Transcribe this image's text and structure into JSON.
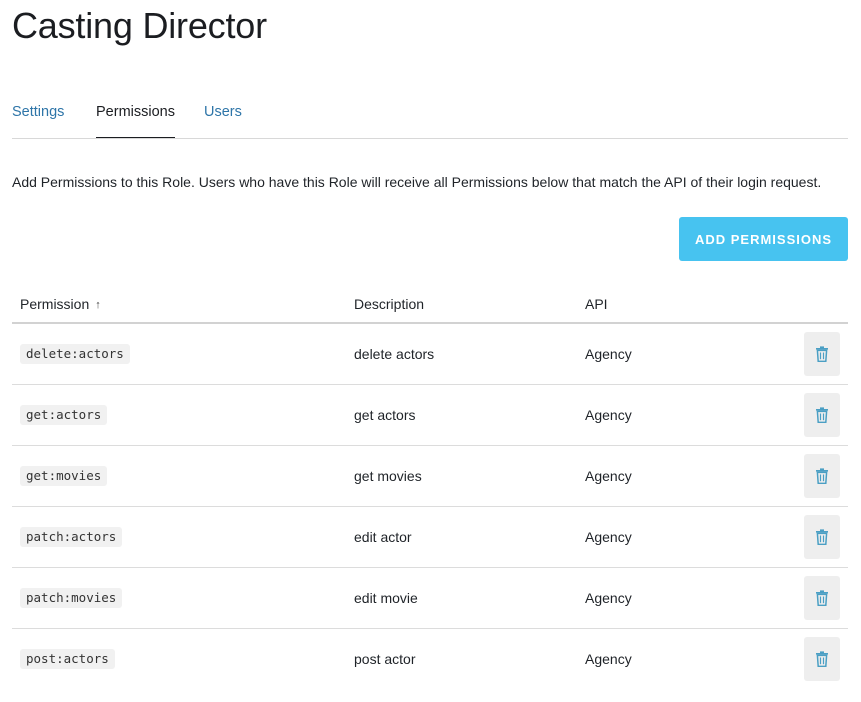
{
  "header": {
    "title": "Casting Director"
  },
  "tabs": [
    {
      "label": "Settings",
      "active": false
    },
    {
      "label": "Permissions",
      "active": true
    },
    {
      "label": "Users",
      "active": false
    }
  ],
  "intro_text": "Add Permissions to this Role. Users who have this Role will receive all Permissions below that match the API of their login request.",
  "add_button_label": "ADD PERMISSIONS",
  "table": {
    "columns": {
      "permission": "Permission",
      "description": "Description",
      "api": "API"
    },
    "sort_indicator": "↑",
    "rows": [
      {
        "permission": "delete:actors",
        "description": "delete actors",
        "api": "Agency",
        "action_icon": "trash-icon"
      },
      {
        "permission": "get:actors",
        "description": "get actors",
        "api": "Agency",
        "action_icon": "trash-icon"
      },
      {
        "permission": "get:movies",
        "description": "get movies",
        "api": "Agency",
        "action_icon": "trash-icon"
      },
      {
        "permission": "patch:actors",
        "description": "edit actor",
        "api": "Agency",
        "action_icon": "trash-icon"
      },
      {
        "permission": "patch:movies",
        "description": "edit movie",
        "api": "Agency",
        "action_icon": "trash-icon"
      },
      {
        "permission": "post:actors",
        "description": "post actor",
        "api": "Agency",
        "action_icon": "trash-icon"
      }
    ]
  },
  "colors": {
    "accent": "#47c3f0",
    "link": "#2e75a8",
    "icon": "#4a9fc4"
  }
}
